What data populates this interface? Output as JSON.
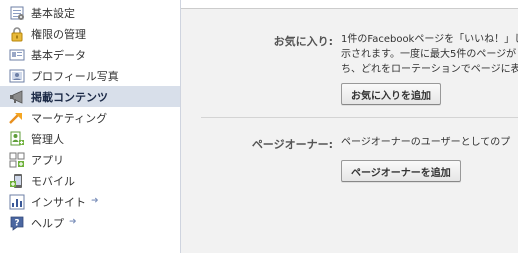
{
  "sidebar": {
    "items": [
      {
        "label": "基本設定",
        "icon": "settings-page-icon",
        "active": false,
        "external": false
      },
      {
        "label": "権限の管理",
        "icon": "lock-icon",
        "active": false,
        "external": false
      },
      {
        "label": "基本データ",
        "icon": "id-card-icon",
        "active": false,
        "external": false
      },
      {
        "label": "プロフィール写真",
        "icon": "photo-icon",
        "active": false,
        "external": false
      },
      {
        "label": "掲載コンテンツ",
        "icon": "megaphone-icon",
        "active": true,
        "external": false
      },
      {
        "label": "マーケティング",
        "icon": "marketing-arrow-icon",
        "active": false,
        "external": false
      },
      {
        "label": "管理人",
        "icon": "admin-icon",
        "active": false,
        "external": false
      },
      {
        "label": "アプリ",
        "icon": "apps-icon",
        "active": false,
        "external": false
      },
      {
        "label": "モバイル",
        "icon": "mobile-icon",
        "active": false,
        "external": false
      },
      {
        "label": "インサイト",
        "icon": "insights-bar-chart-icon",
        "active": false,
        "external": true
      },
      {
        "label": "ヘルプ",
        "icon": "help-question-icon",
        "active": false,
        "external": true
      }
    ],
    "external_glyph": "➜"
  },
  "main": {
    "favorites": {
      "label": "お気に入り:",
      "description_lines": [
        "1件のFacebookページを「いいね！」し",
        "示されます。一度に最大5件のページが",
        "ち、どれをローテーションでページに表"
      ],
      "button_label": "お気に入りを追加"
    },
    "page_owners": {
      "label": "ページオーナー:",
      "description": "ページオーナーのユーザーとしてのプ",
      "button_label": "ページオーナーを追加"
    }
  },
  "colors": {
    "sidebar_active_bg": "#d8dfea",
    "main_bg": "#f2f2f2",
    "facebook_blue": "#3b5998"
  }
}
